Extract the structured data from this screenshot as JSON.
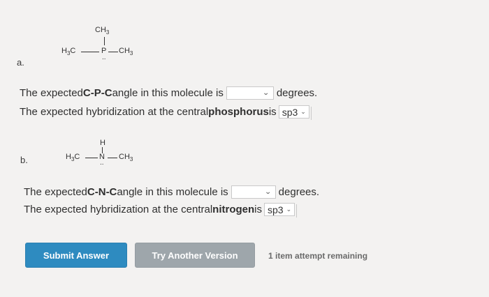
{
  "part_a": {
    "label": "a.",
    "molecule": {
      "top": "CH3",
      "left": "H3C",
      "center": "P",
      "right": "CH3",
      "lone_pair": ".."
    },
    "q1": {
      "prefix": "The expected ",
      "bold": "C-P-C",
      "middle": " angle in this molecule is",
      "selected": "",
      "suffix": "degrees."
    },
    "q2": {
      "prefix": "The expected hybridization at the central ",
      "bold": "phosphorus",
      "middle": " is",
      "selected": "sp3"
    }
  },
  "part_b": {
    "label": "b.",
    "molecule": {
      "top": "H",
      "left": "H3C",
      "center": "N",
      "right": "CH3",
      "lone_pair": ".."
    },
    "q1": {
      "prefix": "The expected ",
      "bold": "C-N-C",
      "middle": " angle in this molecule is",
      "selected": "",
      "suffix": "degrees."
    },
    "q2": {
      "prefix": "The expected hybridization at the central ",
      "bold": "nitrogen",
      "middle": " is",
      "selected": "sp3"
    }
  },
  "buttons": {
    "submit": "Submit Answer",
    "try_another": "Try Another Version"
  },
  "attempts_text": "1 item attempt remaining",
  "icons": {
    "dropdown": "chevron-down-icon"
  },
  "colors": {
    "submit": "#2e8bc0",
    "try_another": "#9ea6ab",
    "background": "#f3f2f1"
  }
}
